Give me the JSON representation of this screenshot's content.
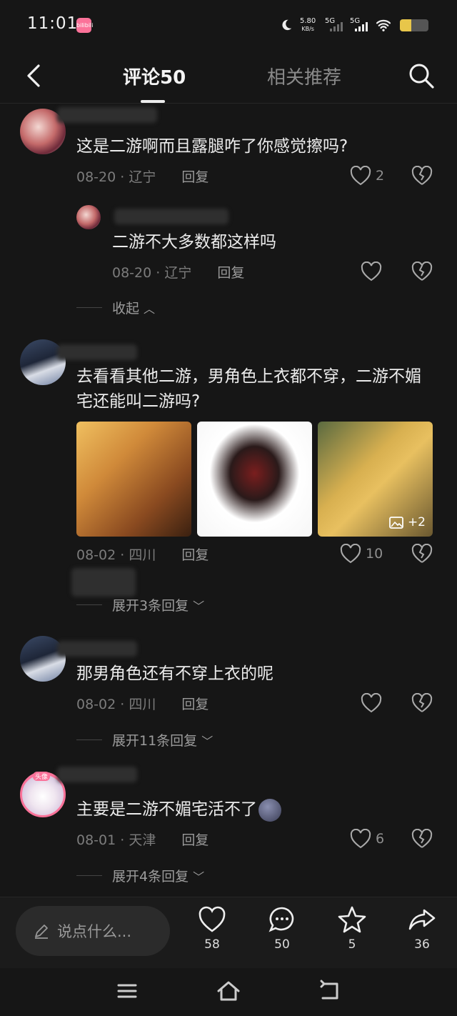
{
  "status_bar": {
    "time": "11:01",
    "app_badge": "bilibili",
    "net_speed_value": "5.80",
    "net_speed_unit": "KB/s",
    "sim1": "5G",
    "sim2": "5G",
    "battery_level": 0.4
  },
  "nav": {
    "tab_comments": "评论50",
    "tab_related": "相关推荐"
  },
  "comments": [
    {
      "text": "这是二游啊而且露腿咋了你感觉擦吗?",
      "date": "08-20",
      "region": "辽宁",
      "reply_label": "回复",
      "likes": "2"
    },
    {
      "text": "二游不大多数都这样吗",
      "date": "08-20",
      "region": "辽宁",
      "reply_label": "回复",
      "collapse_label": "收起"
    },
    {
      "text": "去看看其他二游，男角色上衣都不穿，二游不媚宅还能叫二游吗?",
      "date": "08-02",
      "region": "四川",
      "reply_label": "回复",
      "likes": "10",
      "more_images": "+2",
      "expand_label": "展开3条回复"
    },
    {
      "text": "那男角色还有不穿上衣的呢",
      "date": "08-02",
      "region": "四川",
      "reply_label": "回复",
      "expand_label": "展开11条回复"
    },
    {
      "text": "主要是二游不媚宅活不了",
      "avatar_badge": "头像",
      "date": "08-01",
      "region": "天津",
      "reply_label": "回复",
      "likes": "6",
      "expand_label": "展开4条回复"
    }
  ],
  "meta_separator": "·",
  "bottom_bar": {
    "input_placeholder": "说点什么...",
    "likes": "58",
    "comments": "50",
    "favorites": "5",
    "shares": "36"
  },
  "colors": {
    "background": "#161616",
    "text": "#ececec",
    "muted": "#7c7c7c",
    "accent": "#fb7299"
  }
}
